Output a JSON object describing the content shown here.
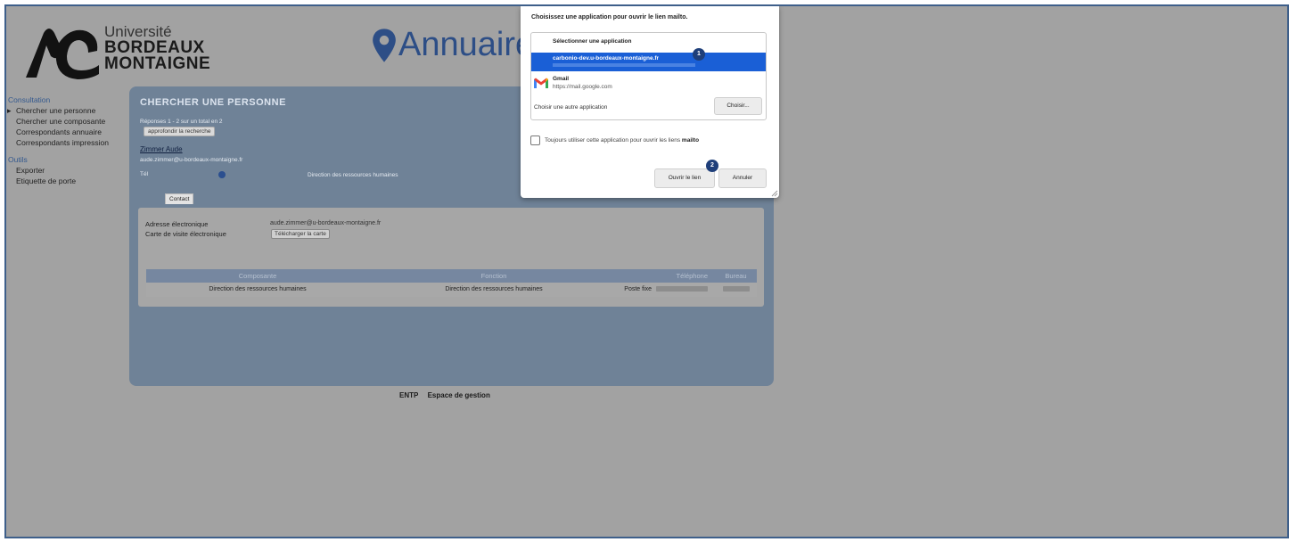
{
  "header": {
    "logo_line1": "Université",
    "logo_line2": "BORDEAUX",
    "logo_line3": "MONTAIGNE",
    "title": "Annuaire"
  },
  "sidebar": {
    "section1": "Consultation",
    "items1": [
      "Chercher une personne",
      "Chercher une composante",
      "Correspondants annuaire",
      "Correspondants impression"
    ],
    "section2": "Outils",
    "items2": [
      "Exporter",
      "Etiquette de porte"
    ]
  },
  "panel": {
    "title": "CHERCHER UNE PERSONNE",
    "results_text": "Réponses 1 - 2 sur un total en 2",
    "refine_button": "approfondir la recherche",
    "person_name": "Zimmer Aude",
    "person_email": "aude.zimmer@u-bordeaux-montaigne.fr",
    "person_phone": "Tél",
    "person_service": "Direction des ressources humaines",
    "tab_contact": "Contact",
    "email_label": "Adresse électronique",
    "email_value": "aude.zimmer@u-bordeaux-montaigne.fr",
    "vcard_label": "Carte de visite électronique",
    "vcard_button": "Télécharger la carte",
    "table_headers": [
      "Composante",
      "Fonction",
      "Téléphone",
      "Bureau"
    ],
    "table_row": {
      "composante": "Direction des ressources humaines",
      "fonction": "Direction des ressources humaines",
      "telephone_label": "Poste fixe"
    }
  },
  "footer": {
    "link1": "ENTP",
    "link2": "Espace de gestion"
  },
  "dialog": {
    "title": "Choisissez une application pour ouvrir le lien mailto.",
    "list_heading": "Sélectionner une application",
    "selected_app": "carbonio-dev.u-bordeaux-montaigne.fr",
    "gmail_name": "Gmail",
    "gmail_url": "https://mail.google.com",
    "other_app": "Choisir une autre application",
    "choose_button": "Choisir...",
    "checkbox_text": "Toujours utiliser cette application pour ouvrir les liens",
    "checkbox_bold": "mailto",
    "open_button": "Ouvrir le lien",
    "cancel_button": "Annuler",
    "badge1": "1",
    "badge2": "2"
  },
  "colors": {
    "accent": "#2d4e86",
    "overlay": "#a2a2a2",
    "selection": "#1a5fd6",
    "badge": "#1f3f7a"
  }
}
